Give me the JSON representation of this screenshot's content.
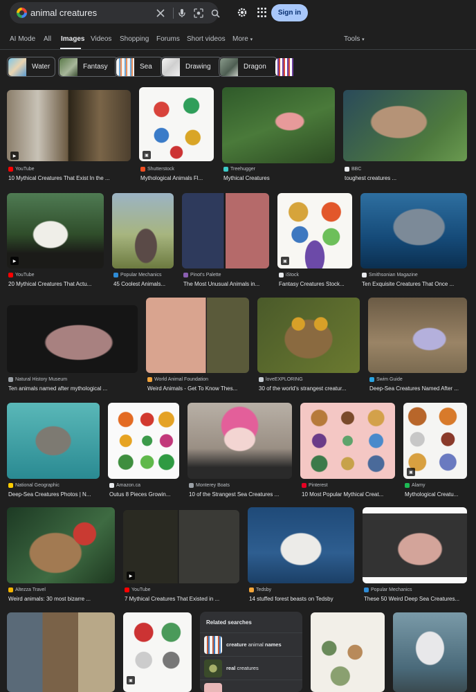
{
  "search": {
    "query": "animal creatures"
  },
  "header": {
    "sign_in_label": "Sign in"
  },
  "tabs": [
    {
      "label": "AI Mode"
    },
    {
      "label": "All"
    },
    {
      "label": "Images"
    },
    {
      "label": "Videos"
    },
    {
      "label": "Shopping"
    },
    {
      "label": "Forums"
    },
    {
      "label": "Short videos"
    },
    {
      "label": "More"
    },
    {
      "label": "Tools"
    }
  ],
  "chips": [
    {
      "label": "Water"
    },
    {
      "label": "Fantasy"
    },
    {
      "label": "Sea"
    },
    {
      "label": "Drawing"
    },
    {
      "label": "Dragon"
    }
  ],
  "results": [
    {
      "source": "YouTube",
      "title": "10 Mythical Creatures That Exist In the ...",
      "color": "#ff0000"
    },
    {
      "source": "Shutterstock",
      "title": "Mythological Animals Fl...",
      "color": "#ee4e23"
    },
    {
      "source": "Treehugger",
      "title": "Mythical Creatures",
      "color": "#3ecbc8"
    },
    {
      "source": "BBC",
      "title": "toughest creatures ...",
      "color": "#e8eaed"
    },
    {
      "source": "YouTube",
      "title": "20 Mythical Creatures That Actu...",
      "color": "#ff0000"
    },
    {
      "source": "Popular Mechanics",
      "title": "45 Coolest Animals...",
      "color": "#2e8bd6"
    },
    {
      "source": "Pinot's Palette",
      "title": "The Most Unusual Animals in...",
      "color": "#8a5fb0"
    },
    {
      "source": "iStock",
      "title": "Fantasy Creatures Stock...",
      "color": "#e8eaed"
    },
    {
      "source": "Smithsonian Magazine",
      "title": "Ten Exquisite Creatures That Once ...",
      "color": "#e8eaed"
    },
    {
      "source": "Natural History Museum",
      "title": "Ten animals named after mythological ...",
      "color": "#9aa0a6"
    },
    {
      "source": "World Animal Foundation",
      "title": "Weird Animals - Get To Know Thes...",
      "color": "#f2a33a"
    },
    {
      "source": "loveEXPLORING",
      "title": "30 of the world's strangest creatur...",
      "color": "#c6ccd2"
    },
    {
      "source": "Swim Guide",
      "title": "Deep-Sea Creatures Named After ...",
      "color": "#2aa3e0"
    },
    {
      "source": "National Geographic",
      "title": "Deep-Sea Creatures Photos | N...",
      "color": "#ffcc00"
    },
    {
      "source": "Amazon.ca",
      "title": "Outus 8 Pieces Growin...",
      "color": "#e8eaed"
    },
    {
      "source": "Monterey Boats",
      "title": "10 of the Strangest Sea Creatures ...",
      "color": "#9aa0a6"
    },
    {
      "source": "Pinterest",
      "title": "10 Most Popular Mythical Creat...",
      "color": "#e60023"
    },
    {
      "source": "Alamy",
      "title": "Mythological Creatu...",
      "color": "#1db954"
    },
    {
      "source": "Altezza Travel",
      "title": "Weird animals: 30 most bizarre ...",
      "color": "#f4b400"
    },
    {
      "source": "YouTube",
      "title": "7 Mythical Creatures That Existed in ...",
      "color": "#ff0000"
    },
    {
      "source": "Tedsby",
      "title": "14 stuffed forest beasts on Tedsby",
      "color": "#f4a63a"
    },
    {
      "source": "Popular Mechanics",
      "title": "These 50 Weird Deep Sea Creatures...",
      "color": "#2e8bd6"
    }
  ],
  "related": {
    "title": "Related searches",
    "items": [
      {
        "bold": "creature",
        "normal": " animal ",
        "bold2": "names"
      },
      {
        "bold": "real",
        "normal": " creatures",
        "bold2": ""
      }
    ]
  }
}
